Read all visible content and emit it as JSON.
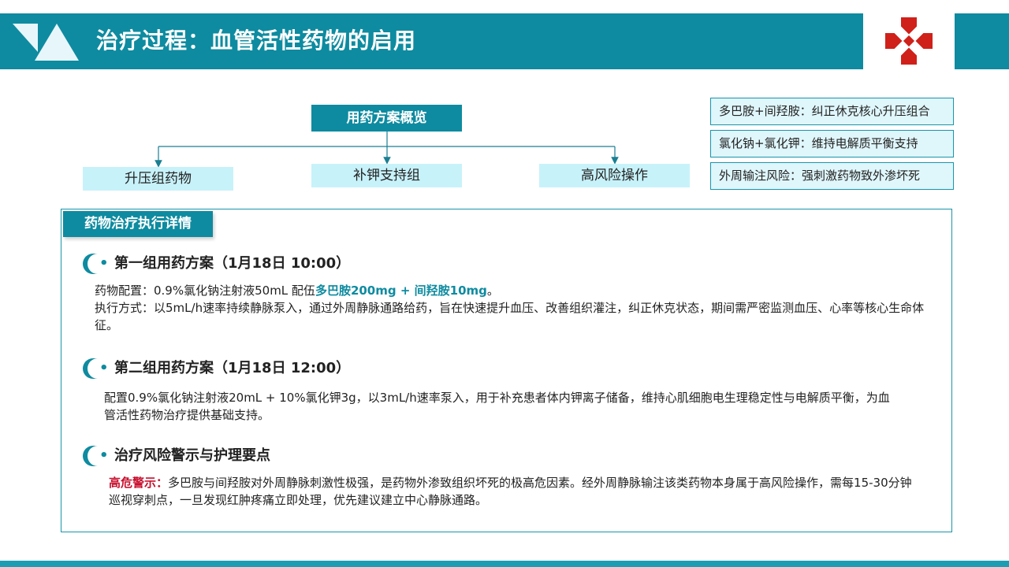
{
  "header": {
    "title": "治疗过程：血管活性药物的启用"
  },
  "overview": {
    "root_label": "用药方案概览",
    "branches": [
      "升压组药物",
      "补钾支持组",
      "高风险操作"
    ]
  },
  "tags": [
    "多巴胺+间羟胺：纠正休克核心升压组合",
    "氯化钠+氯化钾：维持电解质平衡支持",
    "外周输注风险：强刺激药物致外渗坏死"
  ],
  "details": {
    "panel_label": "药物治疗执行详情",
    "sections": [
      {
        "title": "第一组用药方案（1月18日 10:00）",
        "line1_prefix": "药物配置：0.9%氯化钠注射液50mL 配伍",
        "line1_highlight": "多巴胺200mg + 间羟胺10mg",
        "line1_suffix": "。",
        "line2": "执行方式：以5mL/h速率持续静脉泵入，通过外周静脉通路给药，旨在快速提升血压、改善组织灌注，纠正休克状态，期间需严密监测血压、心率等核心生命体征。"
      },
      {
        "title": "第二组用药方案（1月18日 12:00）",
        "text": "配置0.9%氯化钠注射液20mL + 10%氯化钾3g，以3mL/h速率泵入，用于补充患者体内钾离子储备，维持心肌细胞电生理稳定性与电解质平衡，为血管活性药物治疗提供基础支持。"
      },
      {
        "title": "治疗风险警示与护理要点",
        "warn_label": "高危警示：",
        "text": "多巴胺与间羟胺对外周静脉刺激性极强，是药物外渗致组织坏死的极高危因素。经外周静脉输注该类药物本身属于高风险操作，需每15-30分钟巡视穿刺点，一旦发现红肿疼痛立即处理，优先建议建立中心静脉通路。"
      }
    ]
  },
  "colors": {
    "primary": "#0e8ba0",
    "accent_light": "#c8f2fa",
    "warning": "#c8102e",
    "logo_red": "#d0201a"
  }
}
